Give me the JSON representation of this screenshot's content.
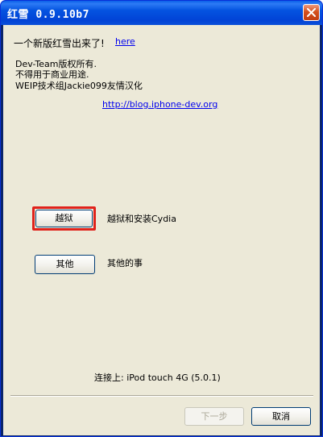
{
  "window": {
    "title": "红雪 0.9.10b7"
  },
  "content": {
    "new_version_text": "一个新版红雪出来了!",
    "new_version_link": "here",
    "credits": [
      "Dev-Team版权所有.",
      "不得用于商业用途.",
      "WEIP技术组Jackie099友情汉化"
    ],
    "blog_link": "http://blog.iphone-dev.org"
  },
  "actions": {
    "jailbreak_button": "越狱",
    "jailbreak_desc": "越狱和安装Cydia",
    "extras_button": "其他",
    "extras_desc": "其他的事"
  },
  "status": {
    "connected": "连接上: iPod touch 4G (5.0.1)"
  },
  "footer": {
    "next_button": "下一步",
    "cancel_button": "取消"
  },
  "colors": {
    "highlight": "#e0221b",
    "titlebar": "#0453e0",
    "dialog_bg": "#ece9d8",
    "link": "#0000ee"
  }
}
